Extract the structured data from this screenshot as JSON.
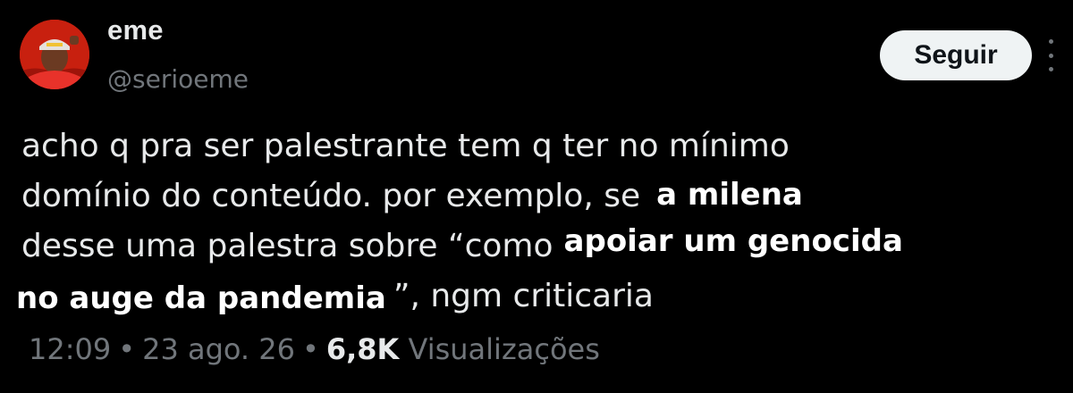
{
  "author": {
    "display_name": "eme",
    "handle": "@serioeme"
  },
  "follow_button": {
    "label": "Seguir"
  },
  "more_menu": {
    "icon": "more-vertical-icon"
  },
  "tweet": {
    "line1": "acho q pra ser palestrante tem q ter no mínimo",
    "line2_plain": "domínio do conteúdo. por exemplo, se",
    "line2_highlight": "a milena",
    "line3_plain": "desse uma palestra sobre “como",
    "line3_highlight": "apoiar um genocida",
    "line4_highlight": "no auge da pandemia",
    "line4_plain": "”, ngm criticaria"
  },
  "meta": {
    "time": "12:09",
    "separator": "•",
    "date": "23 ago. 26",
    "views_count": "6,8K",
    "views_label": "Visualizações"
  },
  "colors": {
    "background": "#000000",
    "primary_text": "#e7e9ea",
    "secondary_text": "#71767b",
    "button_bg": "#eff3f4",
    "button_text": "#0f1419",
    "avatar_red": "#c21b12"
  }
}
